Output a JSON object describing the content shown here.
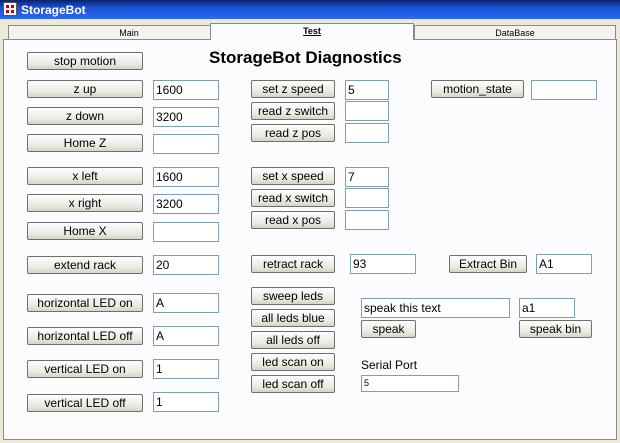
{
  "window": {
    "title": "StorageBot"
  },
  "tabs": [
    {
      "label": "Main"
    },
    {
      "label": "Test"
    },
    {
      "label": "DataBase"
    }
  ],
  "heading": "StorageBot Diagnostics",
  "left": {
    "stop_motion": "stop motion",
    "z_up": {
      "label": "z up",
      "value": "1600"
    },
    "z_down": {
      "label": "z down",
      "value": "3200"
    },
    "home_z": {
      "label": "Home Z",
      "value": ""
    },
    "x_left": {
      "label": "x left",
      "value": "1600"
    },
    "x_right": {
      "label": "x right",
      "value": "3200"
    },
    "home_x": {
      "label": "Home X",
      "value": ""
    },
    "extend_rack": {
      "label": "extend rack",
      "value": "20"
    },
    "h_led_on": {
      "label": "horizontal LED on",
      "value": "A"
    },
    "h_led_off": {
      "label": "horizontal LED off",
      "value": "A"
    },
    "v_led_on": {
      "label": "vertical LED on",
      "value": "1"
    },
    "v_led_off": {
      "label": "vertical LED off",
      "value": "1"
    }
  },
  "middle": {
    "set_z_speed": {
      "label": "set z speed",
      "value": "5"
    },
    "read_z_switch": {
      "label": "read z switch",
      "value": ""
    },
    "read_z_pos": {
      "label": "read z pos",
      "value": ""
    },
    "set_x_speed": {
      "label": "set x speed",
      "value": "7"
    },
    "read_x_switch": {
      "label": "read x switch",
      "value": ""
    },
    "read_x_pos": {
      "label": "read x pos",
      "value": ""
    },
    "retract_rack": {
      "label": "retract rack",
      "value": "93"
    },
    "sweep_leds": "sweep leds",
    "all_leds_blue": "all leds blue",
    "all_leds_off": "all leds off",
    "led_scan_on": "led scan on",
    "led_scan_off": "led scan off"
  },
  "right": {
    "motion_state": {
      "label": "motion_state",
      "value": ""
    },
    "extract_bin": {
      "label": "Extract Bin",
      "value": "A1"
    },
    "speak_text": {
      "value": "speak this text"
    },
    "speak": "speak",
    "bin_value": {
      "value": "a1"
    },
    "speak_bin": "speak bin",
    "serial_port": {
      "label": "Serial Port",
      "value": "5"
    }
  }
}
